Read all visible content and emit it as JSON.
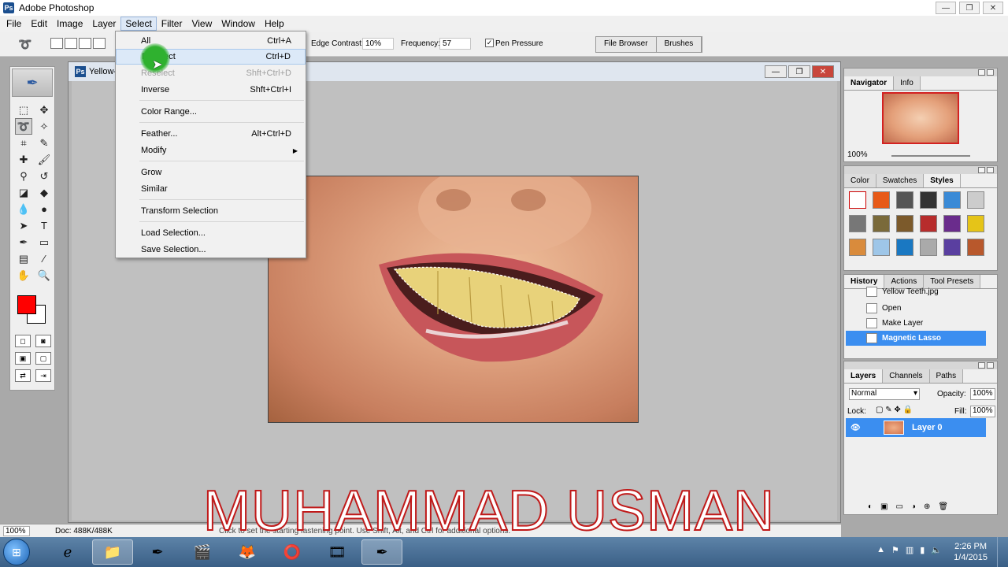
{
  "app": {
    "title": "Adobe Photoshop",
    "icon": "Ps"
  },
  "menubar": [
    "File",
    "Edit",
    "Image",
    "Layer",
    "Select",
    "Filter",
    "View",
    "Window",
    "Help"
  ],
  "options": {
    "edge_contrast_label": "Edge Contrast:",
    "edge_contrast_value": "10%",
    "frequency_label": "Frequency:",
    "frequency_value": "57",
    "pen_pressure_label": "Pen Pressure",
    "pen_pressure_checked": true,
    "palette_well": [
      "File Browser",
      "Brushes"
    ]
  },
  "select_menu": {
    "items": [
      {
        "label": "All",
        "shortcut": "Ctrl+A",
        "disabled": false
      },
      {
        "label": "Deselect",
        "shortcut": "Ctrl+D",
        "disabled": false,
        "highlighted": true
      },
      {
        "label": "Reselect",
        "shortcut": "Shft+Ctrl+D",
        "disabled": true
      },
      {
        "label": "Inverse",
        "shortcut": "Shft+Ctrl+I",
        "disabled": false
      },
      {
        "label": "Color Range...",
        "shortcut": "",
        "disabled": false
      },
      {
        "label": "Feather...",
        "shortcut": "Alt+Ctrl+D",
        "disabled": false
      },
      {
        "label": "Modify",
        "shortcut": "",
        "disabled": false,
        "submenu": true
      },
      {
        "label": "Grow",
        "shortcut": "",
        "disabled": false
      },
      {
        "label": "Similar",
        "shortcut": "",
        "disabled": false
      },
      {
        "label": "Transform Selection",
        "shortcut": "",
        "disabled": false
      },
      {
        "label": "Load Selection...",
        "shortcut": "",
        "disabled": false
      },
      {
        "label": "Save Selection...",
        "shortcut": "",
        "disabled": false
      }
    ]
  },
  "document": {
    "title": "Yellow-"
  },
  "navigator": {
    "tabs": [
      "Navigator",
      "Info"
    ],
    "zoom": "100%"
  },
  "styles": {
    "tabs": [
      "Color",
      "Swatches",
      "Styles"
    ]
  },
  "history": {
    "tabs": [
      "History",
      "Actions",
      "Tool Presets"
    ],
    "items": [
      {
        "label": "Yellow Teeth.jpg",
        "selected": false
      },
      {
        "label": "Open",
        "selected": false
      },
      {
        "label": "Make Layer",
        "selected": false
      },
      {
        "label": "Magnetic Lasso",
        "selected": true
      }
    ]
  },
  "layers": {
    "tabs": [
      "Layers",
      "Channels",
      "Paths"
    ],
    "blend_mode": "Normal",
    "opacity_label": "Opacity:",
    "opacity": "100%",
    "lock_label": "Lock:",
    "fill_label": "Fill:",
    "fill": "100%",
    "layer_name": "Layer 0"
  },
  "status": {
    "zoom": "100%",
    "doc": "Doc: 488K/488K",
    "hint": "Click to set the starting fastening point. Use Shift, Alt, and Ctrl for additional options."
  },
  "watermark": "MUHAMMAD USMAN",
  "taskbar": {
    "time": "2:26 PM",
    "date": "1/4/2015"
  },
  "colors": {
    "foreground": "#ff0000",
    "background": "#ffffff",
    "selection_highlight": "#3b8ef0"
  }
}
